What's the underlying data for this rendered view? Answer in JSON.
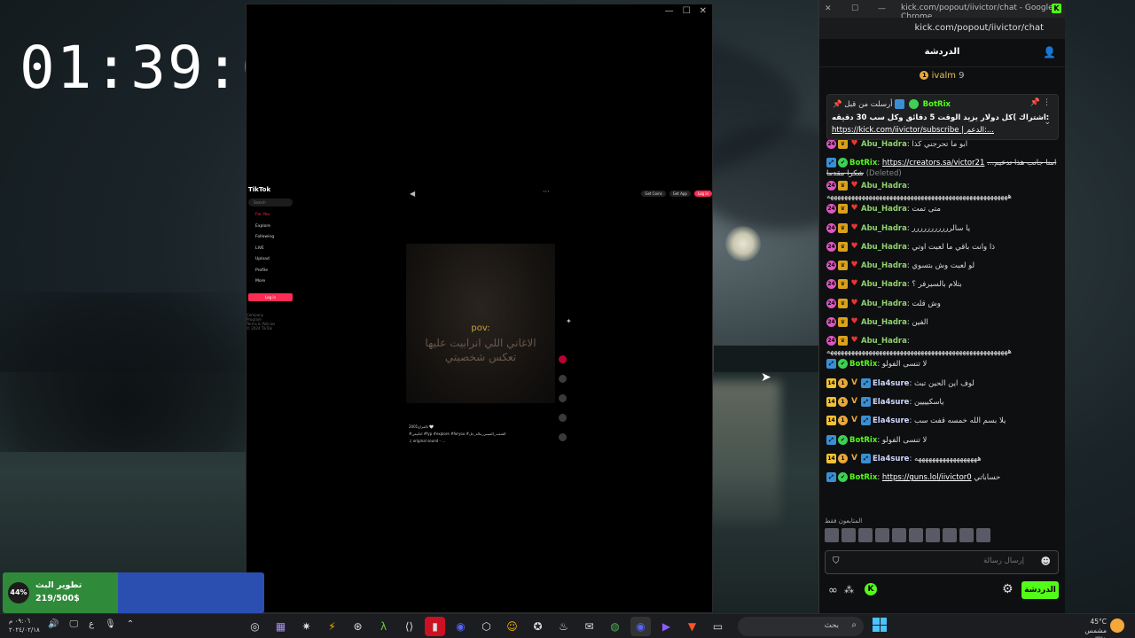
{
  "clock": {
    "time": "01:39:09"
  },
  "tiktok": {
    "logo": "TikTok",
    "search_placeholder": "Search",
    "nav": [
      "For You",
      "Explore",
      "Following",
      "LIVE",
      "Upload",
      "Profile",
      "More"
    ],
    "login": "Log in",
    "footer": [
      "Company",
      "Program",
      "Terms & Policies",
      "© 2024 TikTok"
    ],
    "top_buttons": [
      "Get Coins",
      "Get App",
      "Log in"
    ],
    "video_text_pov": "pov:",
    "video_text_line1": "الاغاني اللي انرابيت عليها",
    "video_text_line2": "تعكس شخصيتي",
    "caption_user": "2001بالمزاج 🤍",
    "caption_tags": "#اغانيمن #fyp #explore #foryou #الشعب_الصيني_ماله_حل",
    "caption_sound": "♫ original sound - ...",
    "counts": [
      "16.8K",
      "1853",
      "1877",
      "2016"
    ]
  },
  "chrome": {
    "title": "kick.com/popout/iivictor/chat - Google Chrome",
    "url": "kick.com/popout/iivictor/chat"
  },
  "chat": {
    "header": "الدردشة",
    "gift_name": "ivalm",
    "gift_count": "9",
    "pinned": {
      "by": "أرسلت من قبل",
      "user": "BotRix",
      "line1": "اشتراك )كل دولار يزيد الوقت 5 دقائق وكل سب 30 دقيقه:",
      "line2_link": "https://kick.com/iivictor/subscribe",
      "line2_tail": "| الدعم:..."
    },
    "messages": [
      {
        "user": "Abu_Hadra",
        "badges": [
          "pink",
          "gold",
          "red"
        ],
        "text": "ابو ما تحرجني كذا",
        "color": "#8fd16f"
      },
      {
        "user": "BotRix",
        "badges": [
          "blue",
          "green"
        ],
        "text": "امنا جانب هذا تدعيم... شكرا مقدما",
        "link": "https://creators.sa/victor21",
        "suffix": "(Deleted)",
        "color": "#53fc18"
      },
      {
        "user": "Abu_Hadra",
        "badges": [
          "pink",
          "gold",
          "red"
        ],
        "text": "ههههههههههههههههههههههههههههههههههههههههههههههههههههه",
        "color": "#8fd16f"
      },
      {
        "user": "Abu_Hadra",
        "badges": [
          "pink",
          "gold",
          "red"
        ],
        "text": "متى تمت",
        "color": "#8fd16f"
      },
      {
        "user": "Abu_Hadra",
        "badges": [
          "pink",
          "gold",
          "red"
        ],
        "text": "يا سالررررررررررر",
        "color": "#8fd16f"
      },
      {
        "user": "Abu_Hadra",
        "badges": [
          "pink",
          "gold",
          "red"
        ],
        "text": "ذا وانت باقي ما لعبت اوتي",
        "color": "#8fd16f"
      },
      {
        "user": "Abu_Hadra",
        "badges": [
          "pink",
          "gold",
          "red"
        ],
        "text": "لو لعبت وش بتسوي",
        "color": "#8fd16f"
      },
      {
        "user": "Abu_Hadra",
        "badges": [
          "pink",
          "gold",
          "red"
        ],
        "text": "بتلام بالسيرفر ؟",
        "color": "#8fd16f"
      },
      {
        "user": "Abu_Hadra",
        "badges": [
          "pink",
          "gold",
          "red"
        ],
        "text": "وش قلت",
        "color": "#8fd16f"
      },
      {
        "user": "Abu_Hadra",
        "badges": [
          "pink",
          "gold",
          "red"
        ],
        "text": "الفين",
        "color": "#8fd16f"
      },
      {
        "user": "Abu_Hadra",
        "badges": [
          "pink",
          "gold",
          "red"
        ],
        "text": "ههههههههههههههههههههههههههههههههههههههههههههههههههههه",
        "color": "#8fd16f"
      },
      {
        "user": "BotRix",
        "badges": [
          "blue",
          "green"
        ],
        "text": "لا تنسى الفولو",
        "color": "#53fc18"
      },
      {
        "user": "Ela4sure",
        "badges": [
          "yellow",
          "orange",
          "v",
          "blue"
        ],
        "text": "لوف اين الحين تبث",
        "color": "#cfd8ff"
      },
      {
        "user": "Ela4sure",
        "badges": [
          "yellow",
          "orange",
          "v",
          "blue"
        ],
        "text": "ياسكيييين",
        "color": "#cfd8ff"
      },
      {
        "user": "Ela4sure",
        "badges": [
          "yellow",
          "orange",
          "v",
          "blue"
        ],
        "text": "يلا بسم الله خمسه قفت سب",
        "color": "#cfd8ff"
      },
      {
        "user": "BotRix",
        "badges": [
          "blue",
          "green"
        ],
        "text": "لا تنسى الفولو",
        "color": "#53fc18"
      },
      {
        "user": "Ela4sure",
        "badges": [
          "yellow",
          "orange",
          "v",
          "blue"
        ],
        "text": "ههههههههههههههههههه",
        "color": "#cfd8ff"
      },
      {
        "user": "BotRix",
        "badges": [
          "blue",
          "green"
        ],
        "text": "حساباتي",
        "link": "https://guns.lol/iivictor0",
        "color": "#53fc18"
      }
    ],
    "followers_label": "المتابعون فقط",
    "input_placeholder": "إرسال رسالة",
    "chat_button": "الدردشة"
  },
  "goal": {
    "title": "تطوير البث",
    "value": "219/500$",
    "percent_label": "44%",
    "percent": 0.44
  },
  "taskbar": {
    "date": "٠٩:٠٦ م",
    "date2": "٢٠٢٤/٠٢/١٨",
    "lang": "ع",
    "search": "بحث",
    "weather_temp": "45°C",
    "weather_desc": "مشمس غالبًا"
  }
}
